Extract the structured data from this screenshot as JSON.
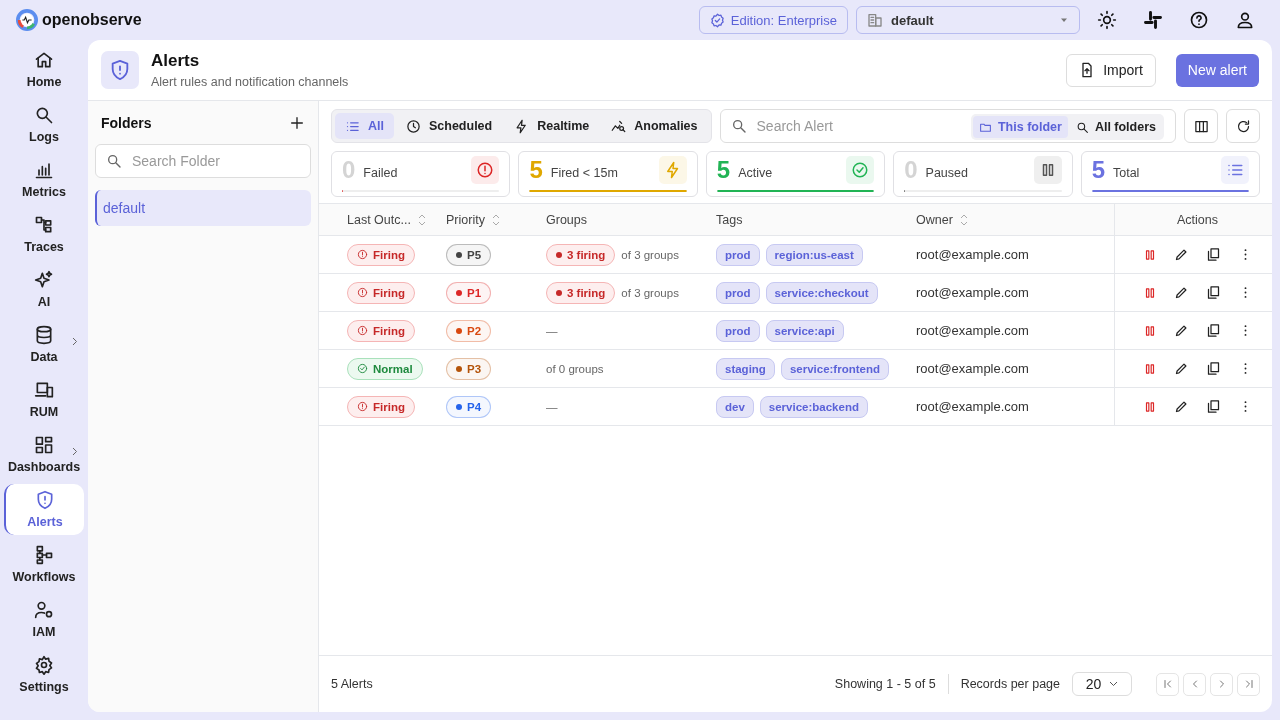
{
  "brand": {
    "name": "openobserve"
  },
  "header": {
    "edition": "Edition: Enterprise",
    "org": "default"
  },
  "nav": [
    {
      "label": "Home",
      "selected": false,
      "submenu": false
    },
    {
      "label": "Logs",
      "selected": false,
      "submenu": false
    },
    {
      "label": "Metrics",
      "selected": false,
      "submenu": false
    },
    {
      "label": "Traces",
      "selected": false,
      "submenu": false
    },
    {
      "label": "AI",
      "selected": false,
      "submenu": false
    },
    {
      "label": "Data",
      "selected": false,
      "submenu": true
    },
    {
      "label": "RUM",
      "selected": false,
      "submenu": false
    },
    {
      "label": "Dashboards",
      "selected": false,
      "submenu": true
    },
    {
      "label": "Alerts",
      "selected": true,
      "submenu": false
    },
    {
      "label": "Workflows",
      "selected": false,
      "submenu": false
    },
    {
      "label": "IAM",
      "selected": false,
      "submenu": false
    },
    {
      "label": "Settings",
      "selected": false,
      "submenu": false
    }
  ],
  "page": {
    "title": "Alerts",
    "subtitle": "Alert rules and notification channels",
    "import": "Import",
    "new": "New alert"
  },
  "folders": {
    "title": "Folders",
    "placeholder": "Search Folder",
    "items": [
      {
        "name": "default",
        "selected": true
      }
    ]
  },
  "type_tabs": [
    {
      "label": "All",
      "selected": true
    },
    {
      "label": "Scheduled",
      "selected": false
    },
    {
      "label": "Realtime",
      "selected": false
    },
    {
      "label": "Anomalies",
      "selected": false
    }
  ],
  "search": {
    "placeholder": "Search Alert",
    "scopes": [
      {
        "label": "This folder",
        "selected": true
      },
      {
        "label": "All folders",
        "selected": false
      }
    ]
  },
  "stats": [
    {
      "count": "0",
      "label": "Failed",
      "level": 0,
      "color": "#dc2626"
    },
    {
      "count": "5",
      "label": "Fired < 15m",
      "level": 1,
      "color": "#e0a800"
    },
    {
      "count": "5",
      "label": "Active",
      "level": 1,
      "color": "#22b455"
    },
    {
      "count": "0",
      "label": "Paused",
      "level": 0,
      "color": "#555555"
    },
    {
      "count": "5",
      "label": "Total",
      "level": 1,
      "color": "#6b72e0"
    }
  ],
  "columns": [
    {
      "label": "Last Outc...",
      "sortable": true
    },
    {
      "label": "Priority",
      "sortable": true
    },
    {
      "label": "Groups",
      "sortable": false
    },
    {
      "label": "Tags",
      "sortable": false
    },
    {
      "label": "Owner",
      "sortable": true
    },
    {
      "label": "Actions",
      "sortable": false
    }
  ],
  "rows": [
    {
      "outcome": {
        "label": "Firing",
        "kind": "firing"
      },
      "priority": {
        "label": "P5",
        "color": "#444444"
      },
      "groups": {
        "firing": "3 firing",
        "text": "of 3 groups"
      },
      "tags": [
        "prod",
        "region:us-east"
      ],
      "owner": "root@example.com"
    },
    {
      "outcome": {
        "label": "Firing",
        "kind": "firing"
      },
      "priority": {
        "label": "P1",
        "color": "#dc2626"
      },
      "groups": {
        "firing": "3 firing",
        "text": "of 3 groups"
      },
      "tags": [
        "prod",
        "service:checkout"
      ],
      "owner": "root@example.com"
    },
    {
      "outcome": {
        "label": "Firing",
        "kind": "firing"
      },
      "priority": {
        "label": "P2",
        "color": "#d9480f"
      },
      "groups": {
        "text": "—"
      },
      "tags": [
        "prod",
        "service:api"
      ],
      "owner": "root@example.com"
    },
    {
      "outcome": {
        "label": "Normal",
        "kind": "normal"
      },
      "priority": {
        "label": "P3",
        "color": "#b45309"
      },
      "groups": {
        "text": "of 0 groups"
      },
      "tags": [
        "staging",
        "service:frontend"
      ],
      "owner": "root@example.com"
    },
    {
      "outcome": {
        "label": "Firing",
        "kind": "firing"
      },
      "priority": {
        "label": "P4",
        "color": "#2563eb"
      },
      "groups": {
        "text": "—"
      },
      "tags": [
        "dev",
        "service:backend"
      ],
      "owner": "root@example.com"
    }
  ],
  "footer": {
    "count": "5 Alerts",
    "showing": "Showing 1 - 5 of 5",
    "rpp_label": "Records per page",
    "rpp": "20"
  }
}
